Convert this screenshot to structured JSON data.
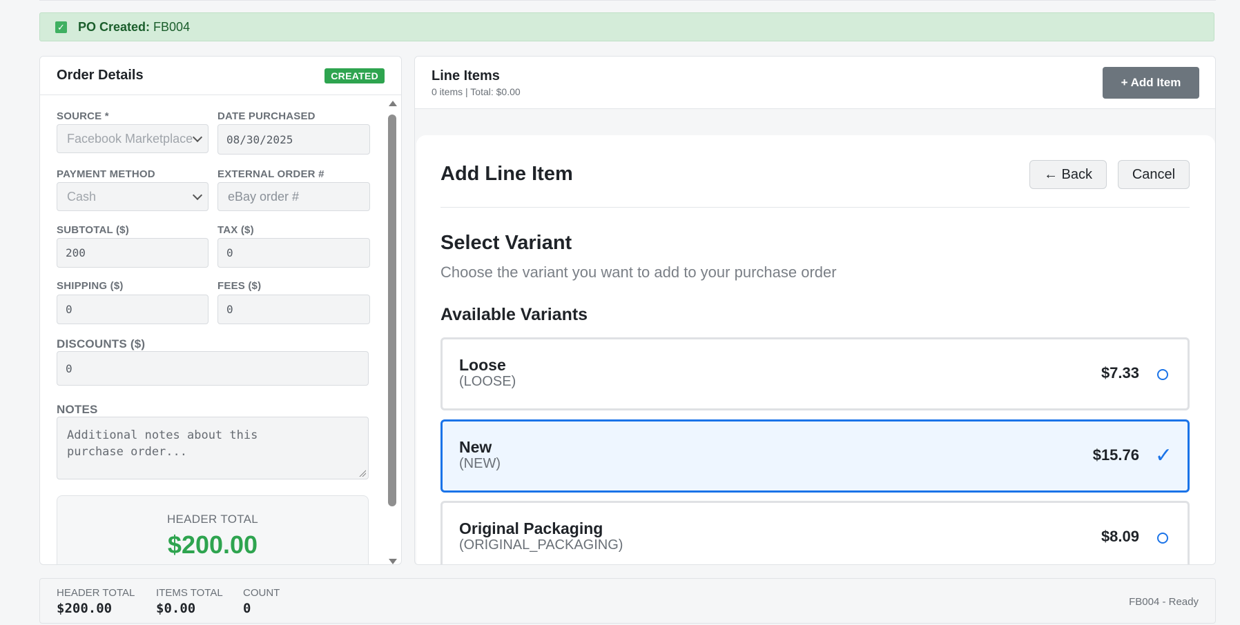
{
  "banner": {
    "label": "PO Created:",
    "value": "FB004"
  },
  "order_details": {
    "title": "Order Details",
    "status_badge": "CREATED",
    "source": {
      "label": "SOURCE *",
      "value": "Facebook Marketplace"
    },
    "date_purchased": {
      "label": "DATE PURCHASED",
      "value": "08/30/2025"
    },
    "payment_method": {
      "label": "PAYMENT METHOD",
      "value": "Cash"
    },
    "external_order": {
      "label": "EXTERNAL ORDER #",
      "placeholder": "eBay order #"
    },
    "subtotal": {
      "label": "SUBTOTAL ($)",
      "value": "200"
    },
    "tax": {
      "label": "TAX ($)",
      "value": "0"
    },
    "shipping": {
      "label": "SHIPPING ($)",
      "value": "0"
    },
    "fees": {
      "label": "FEES ($)",
      "value": "0"
    },
    "discounts": {
      "label": "DISCOUNTS ($)",
      "value": "0"
    },
    "notes": {
      "label": "NOTES",
      "placeholder": "Additional notes about this purchase order..."
    },
    "header_total": {
      "label": "HEADER TOTAL",
      "value": "$200.00"
    }
  },
  "line_items": {
    "title": "Line Items",
    "summary": "0 items | Total: $0.00",
    "add_button": "+ Add Item"
  },
  "add_line_item": {
    "title": "Add Line Item",
    "back_button": "← Back",
    "cancel_button": "Cancel",
    "section_title": "Select Variant",
    "section_desc": "Choose the variant you want to add to your purchase order",
    "variants_title": "Available Variants",
    "variants": [
      {
        "name": "Loose",
        "code": "(LOOSE)",
        "price": "$7.33",
        "selected": false
      },
      {
        "name": "New",
        "code": "(NEW)",
        "price": "$15.76",
        "selected": true
      },
      {
        "name": "Original Packaging",
        "code": "(ORIGINAL_PACKAGING)",
        "price": "$8.09",
        "selected": false
      }
    ],
    "accent_color": "#1a73e8"
  },
  "footer": {
    "header_total": {
      "label": "HEADER TOTAL",
      "value": "$200.00"
    },
    "items_total": {
      "label": "ITEMS TOTAL",
      "value": "$0.00"
    },
    "count": {
      "label": "COUNT",
      "value": "0"
    },
    "status": "FB004 - Ready"
  }
}
